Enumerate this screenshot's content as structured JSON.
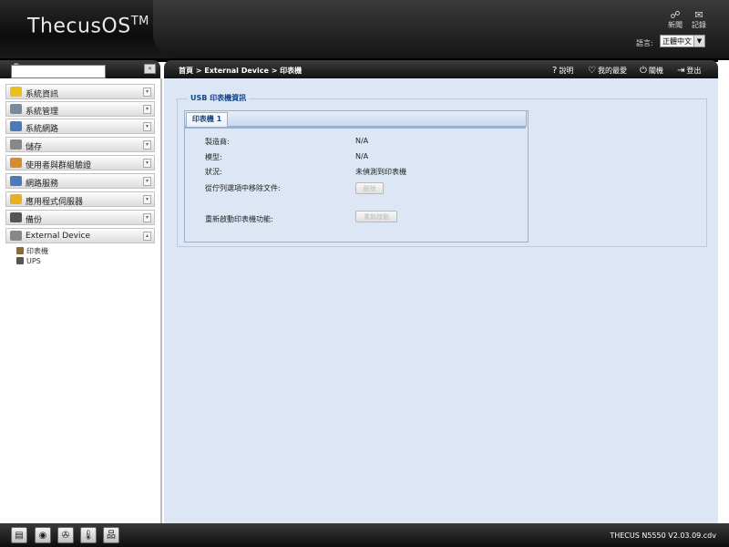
{
  "header": {
    "logo": "ThecusOS",
    "logo_tm": "TM",
    "news_label": "新聞",
    "log_label": "記錄",
    "language_label": "語言:",
    "language_value": "正體中文"
  },
  "sidebar": {
    "items": [
      {
        "label": "系統資訊",
        "icon": "info-icon",
        "color": "#e8c020"
      },
      {
        "label": "系統管理",
        "icon": "tools-icon",
        "color": "#7a8a9a"
      },
      {
        "label": "系統網路",
        "icon": "network-icon",
        "color": "#4a7ab8"
      },
      {
        "label": "儲存",
        "icon": "storage-icon",
        "color": "#888888"
      },
      {
        "label": "使用者與群組驗證",
        "icon": "users-icon",
        "color": "#d88a30"
      },
      {
        "label": "網路服務",
        "icon": "network-service-icon",
        "color": "#4a7ab8"
      },
      {
        "label": "應用程式伺服器",
        "icon": "app-server-icon",
        "color": "#e8b020"
      },
      {
        "label": "備份",
        "icon": "backup-icon",
        "color": "#555555"
      },
      {
        "label": "External Device",
        "icon": "external-device-icon",
        "color": "#888888"
      }
    ],
    "subitems": [
      {
        "label": "印表機",
        "icon": "printer-icon"
      },
      {
        "label": "UPS",
        "icon": "ups-icon"
      }
    ]
  },
  "topbar": {
    "breadcrumb": "首頁 > External Device > 印表機",
    "help": "說明",
    "favorites": "我的最愛",
    "shutdown": "關機",
    "logout": "登出"
  },
  "printer": {
    "fieldset_title": "USB 印表機資訊",
    "tab_label": "印表機 1",
    "manufacturer_label": "製造商:",
    "manufacturer_value": "N/A",
    "model_label": "模型:",
    "model_value": "N/A",
    "status_label": "狀況:",
    "status_value": "未偵測到印表機",
    "remove_label": "從佇列選項中移除文件:",
    "remove_button": "刪除",
    "restart_label": "重新啟動印表機功能:",
    "restart_button": "重新啟動"
  },
  "footer": {
    "version": "THECUS N5550 V2.03.09.cdv"
  }
}
